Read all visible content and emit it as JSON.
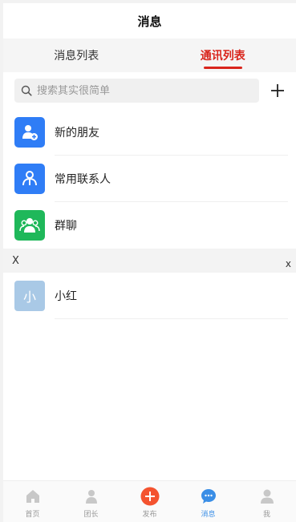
{
  "header": {
    "title": "消息"
  },
  "tabs": [
    {
      "label": "消息列表",
      "active": false
    },
    {
      "label": "通讯列表",
      "active": true
    }
  ],
  "search": {
    "placeholder": "搜索其实很简单",
    "value": ""
  },
  "menu": [
    {
      "label": "新的朋友",
      "icon": "new-friend-icon",
      "color": "#2f7df6"
    },
    {
      "label": "常用联系人",
      "icon": "contacts-icon",
      "color": "#2f7df6"
    },
    {
      "label": "群聊",
      "icon": "group-chat-icon",
      "color": "#1fb85a"
    }
  ],
  "section": {
    "letter": "X",
    "index_letter": "x"
  },
  "contacts": [
    {
      "avatar": "小",
      "name": "小红"
    }
  ],
  "tabbar": [
    {
      "label": "首页",
      "icon": "home-icon"
    },
    {
      "label": "团长",
      "icon": "person-icon"
    },
    {
      "label": "发布",
      "icon": "publish-plus-icon"
    },
    {
      "label": "消息",
      "icon": "message-icon",
      "active": true
    },
    {
      "label": "我",
      "icon": "me-icon"
    }
  ],
  "colors": {
    "accent_red": "#d9251c",
    "accent_blue": "#3a8ee6",
    "publish_orange": "#f4532f"
  }
}
